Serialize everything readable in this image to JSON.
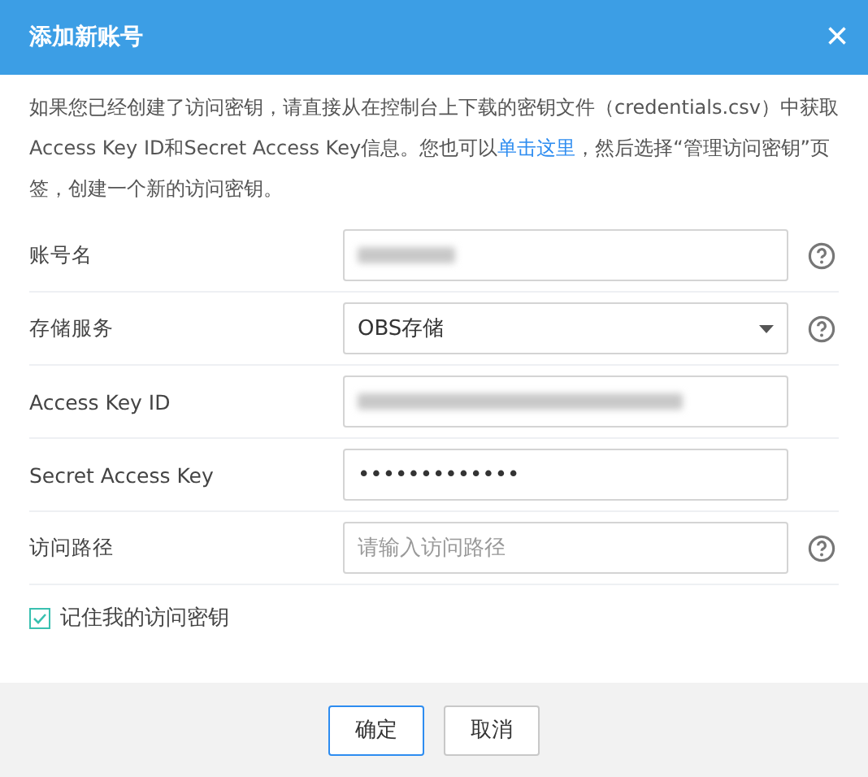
{
  "dialog": {
    "title": "添加新账号",
    "close": "×"
  },
  "intro": {
    "before": "如果您已经创建了访问密钥，请直接从在控制台上下载的密钥文件（credentials.csv）中获取Access Key ID和Secret Access Key信息。您也可以",
    "link": "单击这里",
    "after": "，然后选择“管理访问密钥”页签，创建一个新的访问密钥。"
  },
  "fields": [
    {
      "label": "账号名",
      "kind": "blurred",
      "help": true
    },
    {
      "label": "存储服务",
      "kind": "select",
      "value": "OBS存储",
      "help": true
    },
    {
      "label": "Access Key ID",
      "kind": "blurred",
      "help": false
    },
    {
      "label": "Secret Access Key",
      "kind": "password",
      "value": "•••••••••••••",
      "help": false
    },
    {
      "label": "访问路径",
      "kind": "text",
      "placeholder": "请输入访问路径",
      "help": true
    }
  ],
  "remember": {
    "label": "记住我的访问密钥",
    "checked": true
  },
  "buttons": [
    {
      "label": "确定",
      "primary": true
    },
    {
      "label": "取消",
      "primary": false
    }
  ]
}
